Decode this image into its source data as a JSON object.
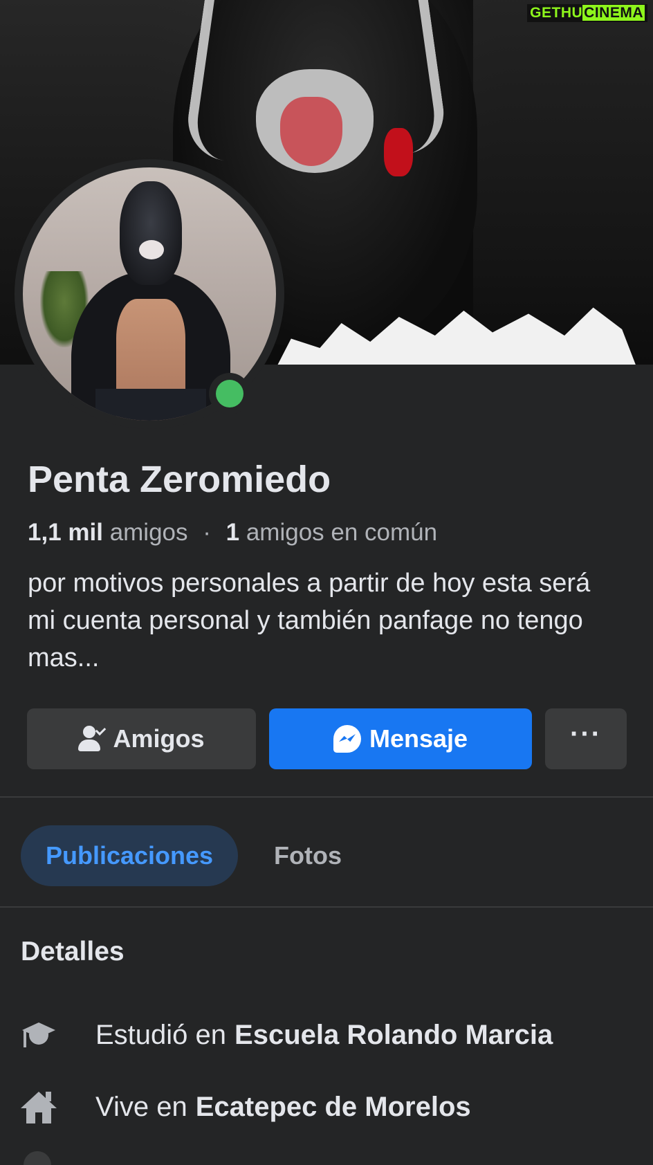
{
  "watermark": {
    "part1": "GETHU",
    "part2": "CINEMA"
  },
  "profile": {
    "name": "Penta Zeromiedo",
    "friends_count": "1,1 mil",
    "friends_label": "amigos",
    "separator": "·",
    "mutual_count": "1",
    "mutual_label": "amigos en común",
    "bio": "por motivos personales a partir de hoy esta será mi cuenta personal y también panfage no tengo mas...",
    "online": true
  },
  "actions": {
    "friends_label": "Amigos",
    "message_label": "Mensaje",
    "more_label": "···"
  },
  "tabs": [
    {
      "label": "Publicaciones",
      "active": true
    },
    {
      "label": "Fotos",
      "active": false
    }
  ],
  "details": {
    "title": "Detalles",
    "items": [
      {
        "icon": "graduation-cap-icon",
        "prefix": "Estudió en",
        "value": "Escuela Rolando Marcia"
      },
      {
        "icon": "house-icon",
        "prefix": "Vive en",
        "value": "Ecatepec de Morelos"
      }
    ]
  },
  "colors": {
    "background": "#242526",
    "primary_blue": "#1877f2",
    "secondary_button": "#3a3b3c",
    "online_green": "#45bd62",
    "active_tab_bg": "#263951",
    "active_tab_text": "#4599ff"
  }
}
